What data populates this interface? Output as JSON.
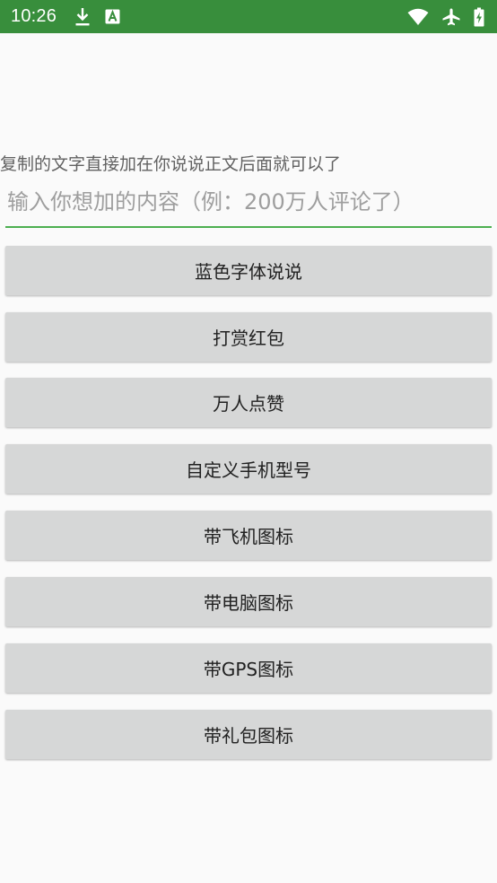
{
  "status_bar": {
    "time": "10:26",
    "background": "#388e3c",
    "left_icons": [
      "download-icon",
      "font-a-icon"
    ],
    "right_icons": [
      "wifi-icon",
      "airplane-icon",
      "battery-charging-icon"
    ]
  },
  "main": {
    "hint": "复制的文字直接加在你说说正文后面就可以了",
    "input": {
      "placeholder": "输入你想加的内容（例：200万人评论了）",
      "value": "",
      "underline_color": "#4caf50"
    },
    "buttons": [
      {
        "label": "蓝色字体说说"
      },
      {
        "label": "打赏红包"
      },
      {
        "label": "万人点赞"
      },
      {
        "label": "自定义手机型号"
      },
      {
        "label": "带飞机图标"
      },
      {
        "label": "带电脑图标"
      },
      {
        "label": "带GPS图标"
      },
      {
        "label": "带礼包图标"
      }
    ]
  }
}
